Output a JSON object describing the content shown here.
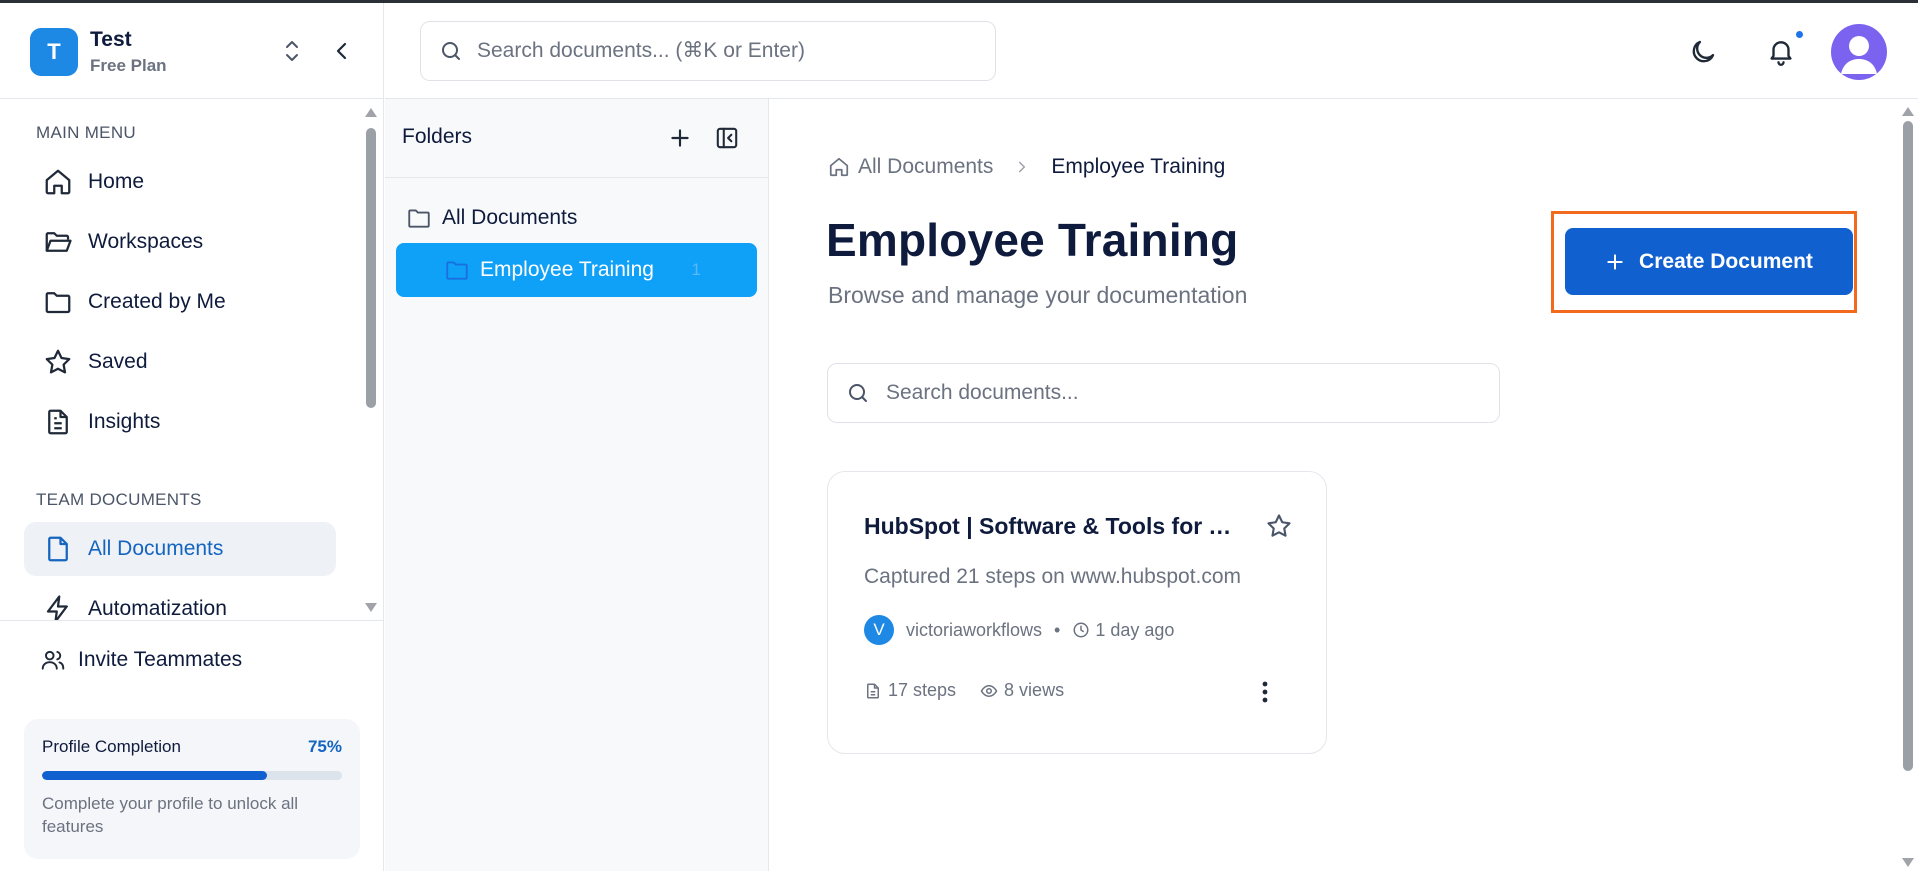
{
  "workspace": {
    "initial": "T",
    "name": "Test",
    "plan": "Free Plan"
  },
  "search": {
    "placeholder": "Search documents... (⌘K or Enter)"
  },
  "sidebar": {
    "main_menu_title": "MAIN MENU",
    "main_items": [
      {
        "label": "Home",
        "icon": "home-icon"
      },
      {
        "label": "Workspaces",
        "icon": "folder-open-icon"
      },
      {
        "label": "Created by Me",
        "icon": "folder-icon"
      },
      {
        "label": "Saved",
        "icon": "star-icon"
      },
      {
        "label": "Insights",
        "icon": "document-icon"
      }
    ],
    "team_title": "TEAM DOCUMENTS",
    "team_items": [
      {
        "label": "All Documents",
        "icon": "file-icon",
        "active": true
      },
      {
        "label": "Automatization",
        "icon": "zap-icon"
      }
    ],
    "invite_label": "Invite Teammates",
    "profile": {
      "title": "Profile Completion",
      "percent_label": "75%",
      "progress": 0.75,
      "description": "Complete your profile to unlock all features"
    }
  },
  "folders": {
    "title": "Folders",
    "items": [
      {
        "label": "All Documents"
      },
      {
        "label": "Employee Training",
        "count": "1",
        "selected": true
      }
    ]
  },
  "main": {
    "breadcrumb_root": "All Documents",
    "breadcrumb_current": "Employee Training",
    "title": "Employee Training",
    "subtitle": "Browse and manage your documentation",
    "create_label": "Create Document",
    "doc_search_placeholder": "Search documents...",
    "documents": [
      {
        "title": "HubSpot | Software & Tools for Your Business",
        "description": "Captured 21 steps on www.hubspot.com",
        "author_initial": "V",
        "author": "victoriaworkflows",
        "time": "1 day ago",
        "steps": "17 steps",
        "views": "8 views"
      }
    ]
  },
  "colors": {
    "accent": "#1060d0",
    "folder_selected": "#0fa0f7",
    "highlight": "#f26b1d"
  }
}
